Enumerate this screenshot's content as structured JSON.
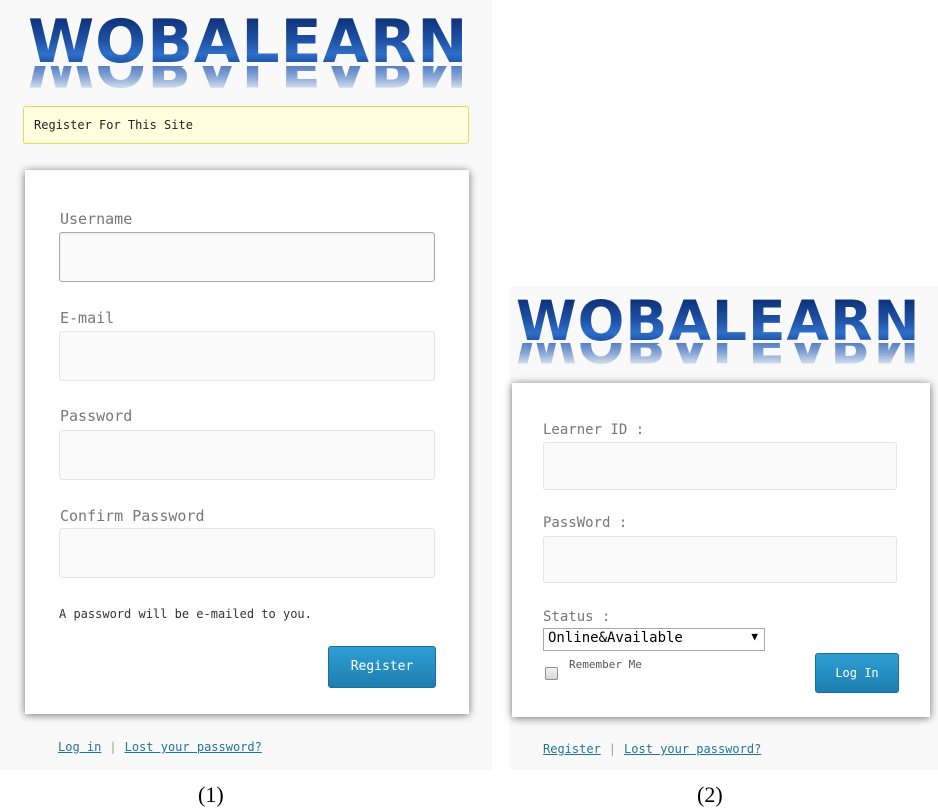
{
  "register_form": {
    "logo_text": "WOBALEARN",
    "notice": "Register For This Site",
    "fields": [
      {
        "label": "Username",
        "value": ""
      },
      {
        "label": "E-mail",
        "value": ""
      },
      {
        "label": "Password",
        "value": ""
      },
      {
        "label": "Confirm Password",
        "value": ""
      }
    ],
    "note": "A password will be e-mailed to you.",
    "submit_label": "Register",
    "links": {
      "login": "Log in",
      "separator": "|",
      "lost_password": "Lost your password?"
    },
    "caption": "(1)"
  },
  "login_form": {
    "logo_text": "WOBALEARN",
    "fields": [
      {
        "label": "Learner ID :",
        "value": ""
      },
      {
        "label": "PassWord :",
        "value": ""
      }
    ],
    "status_label": "Status :",
    "status_selected": "Online&Available",
    "remember_label": "Remember Me",
    "submit_label": "Log In",
    "links": {
      "register": "Register",
      "separator": "|",
      "lost_password": "Lost your password?"
    },
    "caption": "(2)"
  },
  "colors": {
    "accent": "#21759b",
    "button": "#2a8fc4",
    "notice_bg": "#ffffe0",
    "notice_border": "#e6db55"
  }
}
